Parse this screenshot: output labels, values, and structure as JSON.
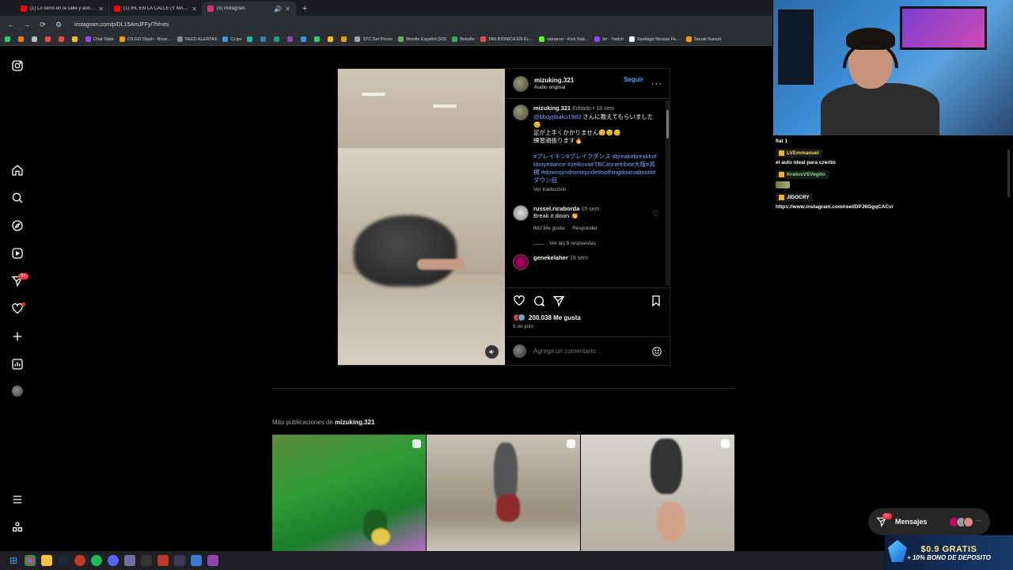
{
  "browser": {
    "tabs": [
      {
        "title": "(1) Lo cerró en la calle y aún así…",
        "color": "#ff0000",
        "active": false
      },
      {
        "title": "(1) IRL EN LA CALLE (Y MAS) C…",
        "color": "#ff0000",
        "active": false
      },
      {
        "title": "(9) Instagram",
        "color": "#e1306c",
        "active": true
      }
    ],
    "url": "instagram.com/p/DL15AmJFFy/?hl=es",
    "bookmarks": [
      {
        "label": "",
        "color": "#2ecc71"
      },
      {
        "label": "",
        "color": "#e67e22"
      },
      {
        "label": "",
        "color": "#bbbbbb"
      },
      {
        "label": "",
        "color": "#e74c3c"
      },
      {
        "label": "",
        "color": "#e74c3c"
      },
      {
        "label": "",
        "color": "#f1c40f"
      },
      {
        "label": "Chat Stats",
        "color": "#9146ff"
      },
      {
        "label": "CS:GO Stash - Brow…",
        "color": "#f39c12"
      },
      {
        "label": "FEED ALERTAS",
        "color": "#7f8c8d"
      },
      {
        "label": "CLips",
        "color": "#3498db"
      },
      {
        "label": "",
        "color": "#1abc9c"
      },
      {
        "label": "",
        "color": "#2980b9"
      },
      {
        "label": "",
        "color": "#16a085"
      },
      {
        "label": "",
        "color": "#8e44ad"
      },
      {
        "label": "",
        "color": "#3498db"
      },
      {
        "label": "",
        "color": "#2ecc71"
      },
      {
        "label": "",
        "color": "#f1c40f"
      },
      {
        "label": "",
        "color": "#f39c12"
      },
      {
        "label": "STC Set Prices",
        "color": "#95a5a6"
      },
      {
        "label": "Wordle Español (ES)",
        "color": "#6aaa64"
      },
      {
        "label": "Boludle",
        "color": "#27ae60"
      },
      {
        "label": "TAN BIONICA EN EL…",
        "color": "#e74c3c"
      },
      {
        "label": "sionaron - Kick Stat…",
        "color": "#53fc18"
      },
      {
        "label": "tirr - Twitch",
        "color": "#9146ff"
      },
      {
        "label": "Santiago Nicolas Fe…",
        "color": "#ffffff"
      },
      {
        "label": "Tanuki Sunset",
        "color": "#f39c12"
      }
    ]
  },
  "post": {
    "username": "mizuking.321",
    "audio": "Audio original",
    "follow_label": "Seguir",
    "caption": {
      "edited": "Editado",
      "sep": "•",
      "age": "18 sem",
      "mention": "@bboyjibaku1983",
      "text1": " さんに教えてもらいました😊",
      "text2": "足が上手くかかりません😊😊😊",
      "text3": "練習頑張ります🔥",
      "hashtags": "#ブレイキン#ブレイクダンス #break#breakin#bboy#dance #zelkova#TBC#onetribe#大阪#高槻 #downsyndromepride#nothingdownaboutit#ダウン症",
      "translate": "Ver traducción"
    },
    "comments": [
      {
        "user": "russel.ricaborda",
        "age": "15 sem",
        "text": "Break it down 👏",
        "likes": "882 Me gusta",
        "reply": "Responder",
        "view_replies": "Ver las 5 respuestas"
      },
      {
        "user": "genekelaher",
        "age": "19 sem"
      }
    ],
    "likes": "200.038 Me gusta",
    "date": "8 de julio",
    "comment_placeholder": "Agrega un comentario..."
  },
  "more_posts": {
    "prefix": "Más publicaciones de ",
    "user": "mizuking.321"
  },
  "messages": {
    "label": "Mensajes",
    "badge": "9+"
  },
  "nav": {
    "badge": "9+"
  },
  "chat": {
    "lines": [
      {
        "kind": "text",
        "text": "flat 1"
      },
      {
        "kind": "user",
        "user": "LVEmmanuel",
        "color": "#ffd966"
      },
      {
        "kind": "text",
        "text": "el auto ideal para czerito"
      },
      {
        "kind": "user",
        "user": "KratosVSVegito",
        "color": "#7ee081"
      },
      {
        "kind": "emote"
      },
      {
        "kind": "user",
        "user": "JIDOCRY",
        "color": "#ffffff"
      },
      {
        "kind": "text",
        "text": "https://www.instagram.com/reel/DPJ6GgqCACv/"
      }
    ]
  },
  "promo": {
    "line1": "$0.9 GRATIS",
    "line2": "+ 10% BONO DE DEPOSITO"
  }
}
